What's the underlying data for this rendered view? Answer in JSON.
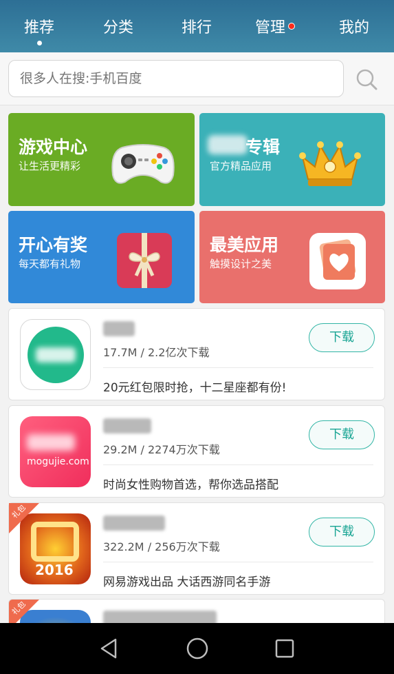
{
  "tabs": [
    {
      "label": "推荐",
      "active": true
    },
    {
      "label": "分类"
    },
    {
      "label": "排行"
    },
    {
      "label": "管理",
      "badge": true
    },
    {
      "label": "我的"
    }
  ],
  "search": {
    "placeholder": "很多人在搜:手机百度"
  },
  "tiles": [
    {
      "title": "游戏中心",
      "subtitle": "让生活更精彩",
      "color": "#6aac24",
      "art": "gamepad-icon"
    },
    {
      "title": "专辑",
      "subtitle": "官方精品应用",
      "color": "#3bb1b8",
      "art": "crown-icon"
    },
    {
      "title": "开心有奖",
      "subtitle": "每天都有礼物",
      "color": "#3189d8",
      "art": "gift-box-icon"
    },
    {
      "title": "最美应用",
      "subtitle": "触摸设计之美",
      "color": "#e9706c",
      "art": "heart-card-icon"
    }
  ],
  "apps": [
    {
      "meta": "17.7M / 2.2亿次下载",
      "desc": "20元红包限时抢，十二星座都有份!",
      "button": "下载"
    },
    {
      "meta": "29.2M / 2274万次下载",
      "desc": "时尚女性购物首选，帮你选品搭配",
      "button": "下载",
      "icon_text": "mogujie.com"
    },
    {
      "meta": "322.2M / 256万次下载",
      "desc": "网易游戏出品 大话西游同名手游",
      "button": "下载",
      "ribbon": "礼包",
      "icon_text": "2016"
    },
    {
      "ribbon": "礼包"
    }
  ],
  "colors": {
    "accent": "#1aa594",
    "topbar": "#2d6f95",
    "badge": "#ff2a1a"
  }
}
